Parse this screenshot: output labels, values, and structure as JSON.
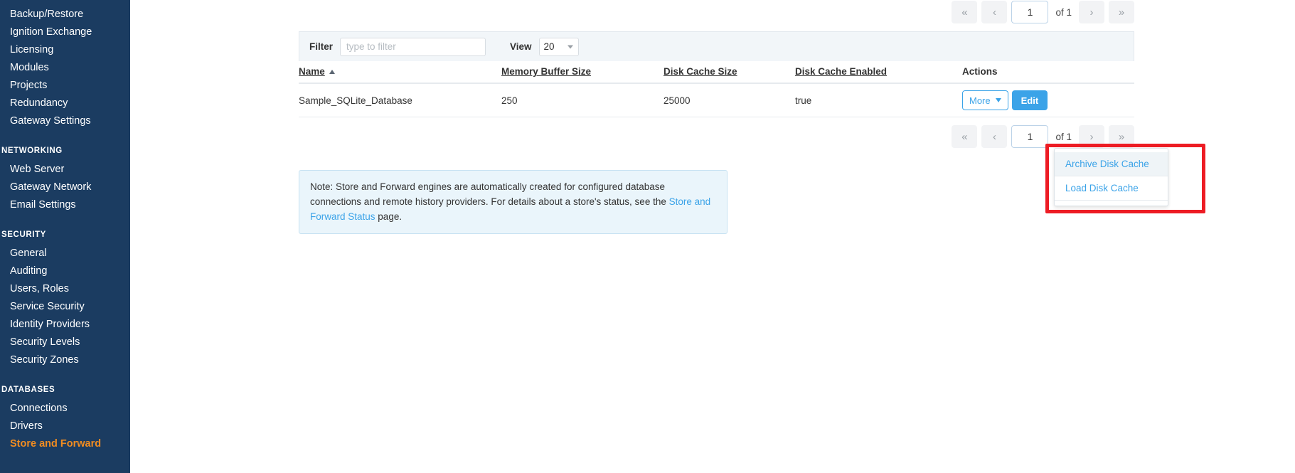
{
  "sidebar": {
    "items": [
      {
        "label": "Backup/Restore",
        "type": "link",
        "active": false
      },
      {
        "label": "Ignition Exchange",
        "type": "link",
        "active": false
      },
      {
        "label": "Licensing",
        "type": "link",
        "active": false
      },
      {
        "label": "Modules",
        "type": "link",
        "active": false
      },
      {
        "label": "Projects",
        "type": "link",
        "active": false
      },
      {
        "label": "Redundancy",
        "type": "link",
        "active": false
      },
      {
        "label": "Gateway Settings",
        "type": "link",
        "active": false
      },
      {
        "label": "NETWORKING",
        "type": "section"
      },
      {
        "label": "Web Server",
        "type": "link",
        "active": false
      },
      {
        "label": "Gateway Network",
        "type": "link",
        "active": false
      },
      {
        "label": "Email Settings",
        "type": "link",
        "active": false
      },
      {
        "label": "SECURITY",
        "type": "section"
      },
      {
        "label": "General",
        "type": "link",
        "active": false
      },
      {
        "label": "Auditing",
        "type": "link",
        "active": false
      },
      {
        "label": "Users, Roles",
        "type": "link",
        "active": false
      },
      {
        "label": "Service Security",
        "type": "link",
        "active": false
      },
      {
        "label": "Identity Providers",
        "type": "link",
        "active": false
      },
      {
        "label": "Security Levels",
        "type": "link",
        "active": false
      },
      {
        "label": "Security Zones",
        "type": "link",
        "active": false
      },
      {
        "label": "DATABASES",
        "type": "section"
      },
      {
        "label": "Connections",
        "type": "link",
        "active": false
      },
      {
        "label": "Drivers",
        "type": "link",
        "active": false
      },
      {
        "label": "Store and Forward",
        "type": "link",
        "active": true
      }
    ],
    "colors": {
      "background": "#1b3c61",
      "link": "#ffffff",
      "active": "#f08c21"
    }
  },
  "pagination": {
    "first_label": "«",
    "prev_label": "‹",
    "page_value": "1",
    "of_label": "of 1",
    "next_label": "›",
    "last_label": "»"
  },
  "filter_bar": {
    "filter_label": "Filter",
    "filter_value": "",
    "filter_placeholder": "type to filter",
    "view_label": "View",
    "view_value": "20"
  },
  "table": {
    "columns": [
      {
        "label": "Name",
        "sorted": "asc"
      },
      {
        "label": "Memory Buffer Size",
        "sorted": ""
      },
      {
        "label": "Disk Cache Size",
        "sorted": ""
      },
      {
        "label": "Disk Cache Enabled",
        "sorted": ""
      },
      {
        "label": "Actions",
        "sorted": ""
      }
    ],
    "rows": [
      {
        "name": "Sample_SQLite_Database",
        "memory_buffer_size": "250",
        "disk_cache_size": "25000",
        "disk_cache_enabled": "true",
        "more_label": "More",
        "edit_label": "Edit"
      }
    ]
  },
  "dropdown": {
    "items": [
      {
        "label": "Archive Disk Cache",
        "hovered": true
      },
      {
        "label": "Load Disk Cache",
        "hovered": false
      }
    ]
  },
  "note": {
    "text_part1": "Note: Store and Forward engines are automatically created for configured database connections and remote history providers. For details about a store's status, see the ",
    "link_text": "Store and Forward Status",
    "text_part2": " page."
  },
  "annotation": {
    "highlight_color": "#ed1c24"
  }
}
